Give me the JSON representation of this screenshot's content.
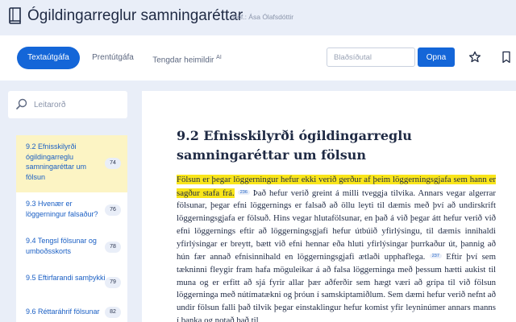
{
  "header": {
    "title": "Ógildingarreglur samningaréttar",
    "author": "Höf.: Ása Ólafsdóttir"
  },
  "toolbar": {
    "tabs": [
      {
        "label": "Textaútgáfa",
        "active": true
      },
      {
        "label": "Prentútgáfa",
        "active": false
      },
      {
        "label": "Tengdar heimildir",
        "badge": "AI",
        "active": false
      }
    ],
    "page_input_placeholder": "Blaðsíðutal",
    "open_label": "Opna",
    "icons": [
      "star-icon",
      "bookmark-icon"
    ]
  },
  "sidebar": {
    "search_placeholder": "Leitarorð",
    "toc": [
      {
        "label": "9.2 Efnisskilyrði ógildingarreglu samningaréttar um fölsun",
        "page": "74",
        "active": true
      },
      {
        "label": "9.3 Hvenær er löggerningur falsaður?",
        "page": "76",
        "active": false
      },
      {
        "label": "9.4 Tengsl fölsunar og umboðsskorts",
        "page": "78",
        "active": false
      },
      {
        "label": "9.5 Eftirfarandi samþykki",
        "page": "79",
        "active": false
      },
      {
        "label": "9.6 Réttaráhrif fölsunar",
        "page": "82",
        "active": false
      }
    ]
  },
  "content": {
    "title": "9.2 Efnisskilyrði ógildingarreglu samningaréttar um fölsun",
    "highlighted": "Fölsun er þegar löggerningur hefur ekki verið gerður af þeim löggerningsgjafa sem hann er sagður stafa frá.",
    "fn1": "236",
    "text1": "Það hefur verið greint á milli tveggja tilvika. Annars vegar algerrar fölsunar, þegar efni löggernings er falsað að öllu leyti til dæmis með því að undirskrift löggerningsgjafa er fölsuð. Hins vegar hlutafölsunar, en það á við þegar átt hefur verið við efni löggernings eftir að löggerningsgjafi hefur útbúið yfirlýsingu, til dæmis innihaldi yfirlýsingar er breytt, bætt við efni hennar eða hluti yfirlýsingar þurrkaður út, þannig að hún fær annað efnisinnihald en löggerningsgjafi ætlaði upphaflega.",
    "fn2": "237",
    "text2": "Eftir því sem tækninni fleygir fram hafa möguleikar á að falsa löggerninga með þessum hætti aukist til muna og er erfitt að sjá fyrir allar þær aðferðir sem hægt væri að grípa til við fölsun löggerninga með nútímatækni og þróun í samskiptamiðlum. Sem dæmi hefur verið nefnt að undir fölsun falli það tilvik þegar einstaklingur hefur komist yfir leyninúmer annars manns í banka og notað það til"
  }
}
